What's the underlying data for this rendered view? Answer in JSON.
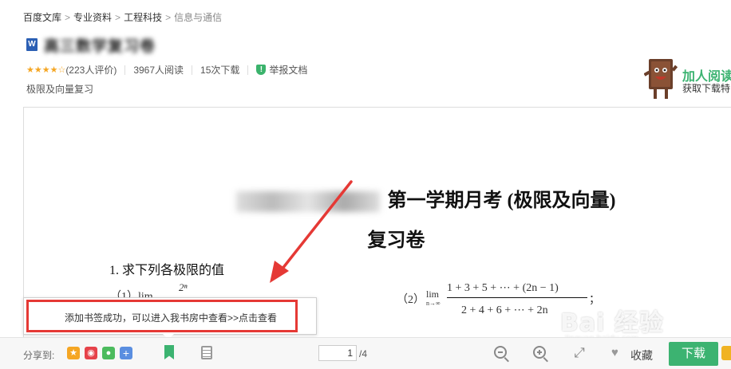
{
  "breadcrumb": {
    "items": [
      "百度文库",
      "专业资料",
      "工程科技"
    ],
    "current": "信息与通信",
    "separator": ">"
  },
  "document": {
    "title": "高三数学复习卷",
    "file_type_icon": "W",
    "rating_stars": "★★★★☆",
    "reviews": "(223人评价)",
    "reads": "3967人阅读",
    "downloads": "15次下载",
    "report_label": "举报文档",
    "tag": "极限及向量复习"
  },
  "promo": {
    "title": "加人阅读",
    "subtitle": "获取下载特"
  },
  "page_content": {
    "heading": "第一学期月考 (极限及向量)",
    "subheading": "复习卷",
    "question1": "1. 求下列各极限的值",
    "part1": "（1）lim",
    "part1_n": "2ⁿ",
    "part2": "（2）",
    "lim": "lim",
    "lim_sub": "n→∞",
    "numerator": "1 + 3 + 5 + ⋯ + (2n − 1)",
    "denominator": "2 + 4 + 6 + ⋯ + 2n",
    "semicolon": "；"
  },
  "toast": {
    "message": "添加书签成功，可以进入我书房中查看>>点击查看"
  },
  "toolbar": {
    "share_label": "分享到:",
    "page_current": "1",
    "page_total": "/4",
    "favorite_label": "收藏",
    "download_label": "下载"
  },
  "colors": {
    "accent_green": "#3cb371",
    "highlight_red": "#e53935",
    "star_orange": "#f5a623"
  },
  "watermark": {
    "text": "Bai 经验",
    "url": "jingyan.baidu.com"
  }
}
